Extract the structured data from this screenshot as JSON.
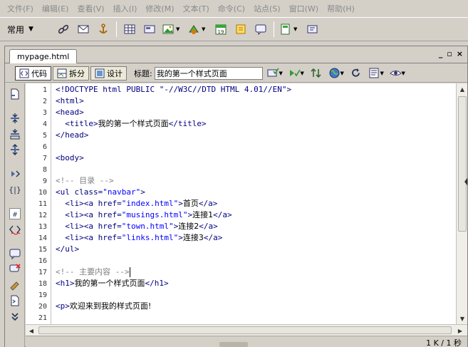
{
  "menu": [
    "文件(F)",
    "编辑(E)",
    "查看(V)",
    "插入(I)",
    "修改(M)",
    "文本(T)",
    "命令(C)",
    "站点(S)",
    "窗口(W)",
    "帮助(H)"
  ],
  "insert_bar": {
    "category": "常用"
  },
  "document": {
    "tab_name": "mypage.html",
    "window_controls": [
      "_",
      "▫",
      "×"
    ],
    "view_code": "代码",
    "view_split": "拆分",
    "view_design": "设计",
    "title_label": "标题:",
    "title_value": "我的第一个样式页面"
  },
  "code_lines": [
    {
      "n": "1"
    },
    {
      "n": "2"
    },
    {
      "n": "3"
    },
    {
      "n": "4"
    },
    {
      "n": "5"
    },
    {
      "n": "6"
    },
    {
      "n": "7"
    },
    {
      "n": "8"
    },
    {
      "n": "9"
    },
    {
      "n": "10"
    },
    {
      "n": "11"
    },
    {
      "n": "12"
    },
    {
      "n": "13"
    },
    {
      "n": "14"
    },
    {
      "n": "15"
    },
    {
      "n": "16"
    },
    {
      "n": "17"
    },
    {
      "n": "18"
    },
    {
      "n": "19"
    },
    {
      "n": "20"
    },
    {
      "n": "21"
    }
  ],
  "code_text": {
    "l1": "<!DOCTYPE html PUBLIC \"-//W3C//DTD HTML 4.01//EN\">",
    "l2": "<html>",
    "l3": "<head>",
    "l4_open": "  <title>",
    "l4_text": "我的第一个样式页面",
    "l4_close": "</title>",
    "l5": "</head>",
    "l7": "<body>",
    "l9": "<!-- 目录 -->",
    "l10_tag": "<ul ",
    "l10_attr": "class=",
    "l10_val": "\"navbar\"",
    "l10_end": ">",
    "l11_a": "  <li><a ",
    "l11_attr": "href=",
    "l11_val": "\"index.html\"",
    "l11_gt": ">",
    "l11_text": "首页",
    "l11_close": "</a>",
    "l12_a": "  <li><a ",
    "l12_attr": "href=",
    "l12_val": "\"musings.html\"",
    "l12_gt": ">",
    "l12_text": "连接1",
    "l12_close": "</a>",
    "l13_a": "  <li><a ",
    "l13_attr": "href=",
    "l13_val": "\"town.html\"",
    "l13_gt": ">",
    "l13_text": "连接2",
    "l13_close": "</a>",
    "l14_a": "  <li><a ",
    "l14_attr": "href=",
    "l14_val": "\"links.html\"",
    "l14_gt": ">",
    "l14_text": "连接3",
    "l14_close": "</a>",
    "l15": "</ul>",
    "l17": "<!-- 主要内容 -->",
    "l18_open": "<h1>",
    "l18_text": "我的第一个样式页面",
    "l18_close": "</h1>",
    "l20_open": "<p>",
    "l20_text": "欢迎来到我的样式页面!"
  },
  "status": {
    "size_time": "1 K / 1 秒"
  },
  "colors": {
    "tag": "#000080",
    "value": "#0000ff",
    "comment": "#808080",
    "chrome": "#d4d0c8"
  }
}
